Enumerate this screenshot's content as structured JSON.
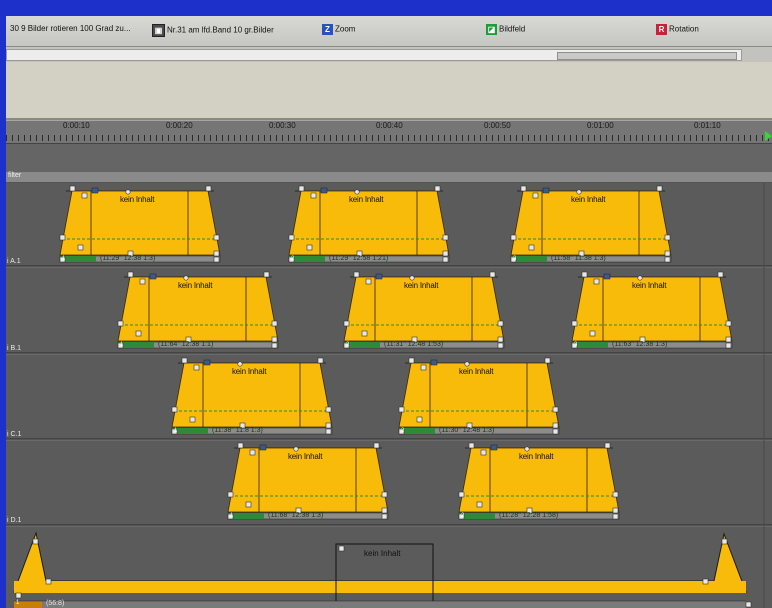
{
  "toolbar": {
    "items": [
      {
        "label": "30  9 Bilder rotieren 100 Grad zu...",
        "icon": "",
        "color": ""
      },
      {
        "label": "Nr.31 am lfd.Band 10 gr.Bilder",
        "icon": "film-icon",
        "color": "#4b4b4b"
      },
      {
        "label": "Zoom",
        "icon": "Z",
        "color": "#2a52b8"
      },
      {
        "label": "Bildfeld",
        "icon": "bildfeld-icon",
        "color": "#1f9c3a"
      },
      {
        "label": "Rotation",
        "icon": "R",
        "color": "#c8213a"
      }
    ]
  },
  "ruler": {
    "ticks": [
      "0:00:10",
      "0:00:20",
      "0:00:30",
      "0:00:40",
      "0:00:50",
      "0:01:00",
      "0:01:10"
    ]
  },
  "filter_label": "filter",
  "tracks": [
    {
      "label": "i A.1"
    },
    {
      "label": "i B.1"
    },
    {
      "label": "i C.1"
    },
    {
      "label": "i D.1"
    }
  ],
  "clips": [
    {
      "title": "kein Inhalt",
      "info": "(11:29\" 12:38 1:3)",
      "index": "1"
    },
    {
      "title": "kein Inhalt",
      "info": "(11:29\" 12:58 1:21)",
      "index": "2"
    },
    {
      "title": "kein Inhalt",
      "info": "(11:58\" 11:38 1:3)",
      "index": "3"
    },
    {
      "title": "kein Inhalt",
      "info": "(11:64\" 12:38 1:1)",
      "index": "1"
    },
    {
      "title": "kein Inhalt",
      "info": "(11:31\" 12:48 1:53)",
      "index": "2"
    },
    {
      "title": "kein Inhalt",
      "info": "(11:63\" 12:38 1:3)",
      "index": "3"
    },
    {
      "title": "kein Inhalt",
      "info": "(11:38\" 11:8 1:3)",
      "index": "1"
    },
    {
      "title": "kein Inhalt",
      "info": "(11:30\" 12:48 1:3)",
      "index": "2"
    },
    {
      "title": "kein Inhalt",
      "info": "(11:68\" 12:38 1:3)",
      "index": "1"
    },
    {
      "title": "kein Inhalt",
      "info": "(11:28\" 12:28 1:58)",
      "index": "2"
    }
  ],
  "master": {
    "title": "kein Inhalt",
    "info": "(56:8)",
    "index": "1"
  },
  "colors": {
    "clip_fill": "#f9bb0a",
    "clip_green": "#2e8a3b",
    "background": "#5b5b5b",
    "window_border": "#1d30c9"
  }
}
